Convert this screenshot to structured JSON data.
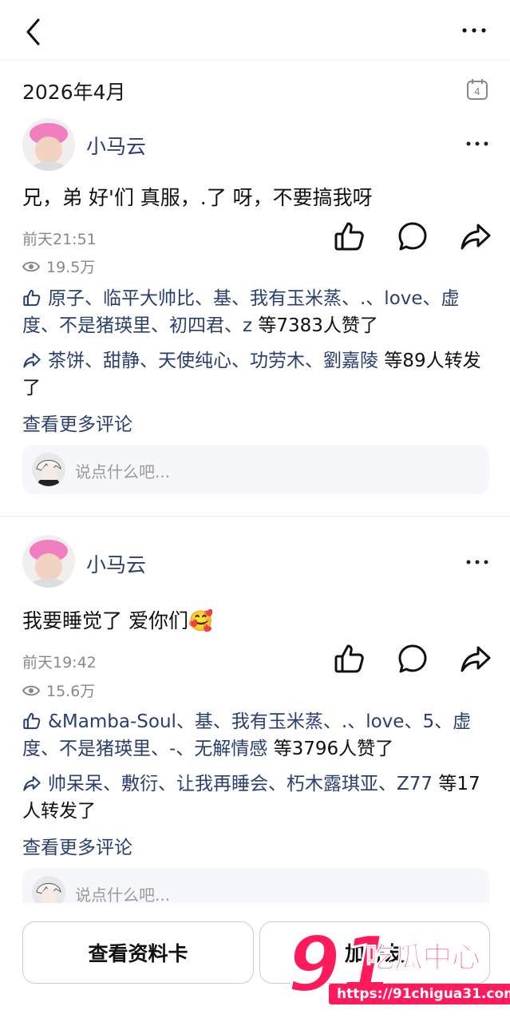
{
  "header": {
    "back_icon": "chevron-left-icon",
    "more_icon": "more-horizontal-icon"
  },
  "feed": {
    "month": "2026年4月",
    "calendar_day": "4"
  },
  "posts": [
    {
      "author": "小马云",
      "content": "兄，弟 好'们 真服，.了 呀，不要搞我呀",
      "time": "前天21:51",
      "views": "19.5万",
      "likes_names": "原子、临平大帅比、基、我有玉米蒸、.、love、虚度、不是猪瑛里、初四君、z",
      "likes_tail": " 等7383人赞了",
      "shares_names": "茶饼、甜静、天使纯心、功劳木、劉嘉陵",
      "shares_tail": " 等89人转发了",
      "more_comments": "查看更多评论",
      "comment_placeholder": "说点什么吧..."
    },
    {
      "author": "小马云",
      "content": "我要睡觉了 爱你们🥰",
      "time": "前天19:42",
      "views": "15.6万",
      "likes_names": "&Mamba-Soul、基、我有玉米蒸、.、love、5、虚度、不是猪瑛里、-、无解情感",
      "likes_tail": " 等3796人赞了",
      "shares_names": "帅呆呆、敷衍、让我再睡会、朽木露琪亚、Z77",
      "shares_tail": " 等17人转发了",
      "more_comments": "查看更多评论",
      "comment_placeholder": "说点什么吧..."
    }
  ],
  "footer": {
    "profile_button": "查看资料卡",
    "add_friend_button": "加好友"
  },
  "watermark": {
    "number": "91",
    "name": "吃瓜中心",
    "url": "https://91chigua31.com"
  },
  "colors": {
    "name_blue": "#2a3f6e",
    "muted": "#888888",
    "watermark": "#ff1a5b"
  }
}
